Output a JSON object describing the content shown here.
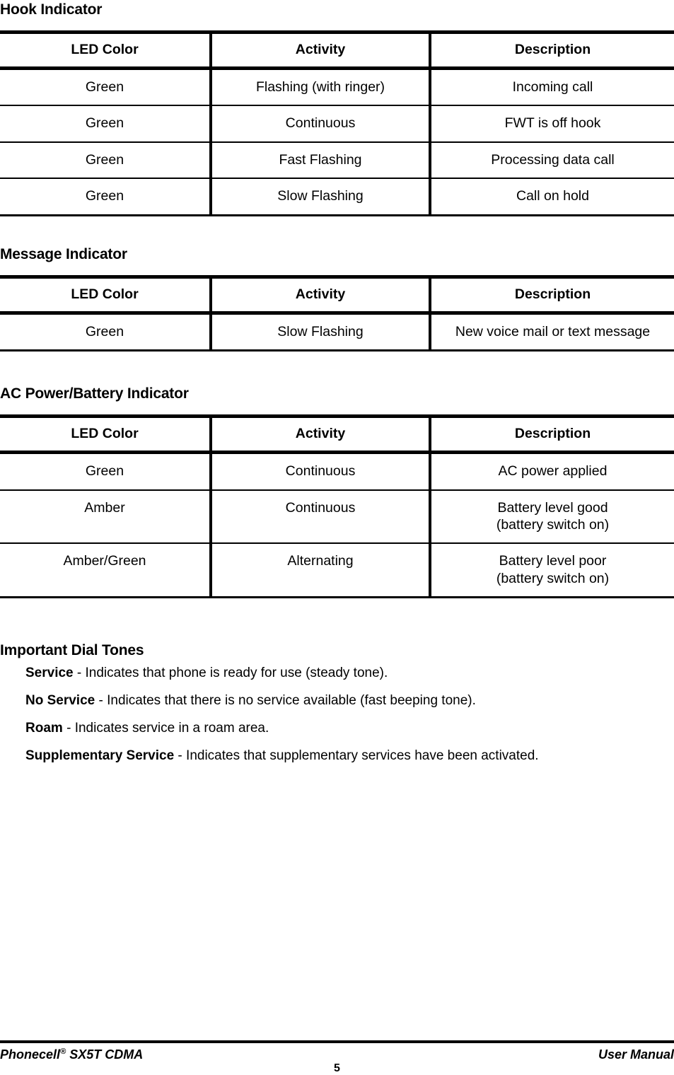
{
  "document": {
    "columns": [
      "LED Color",
      "Activity",
      "Description"
    ]
  },
  "sections": [
    {
      "heading": "Hook Indicator",
      "table": {
        "headers": [
          "LED Color",
          "Activity",
          "Description"
        ],
        "rows": [
          [
            "Green",
            "Flashing (with ringer)",
            "Incoming call"
          ],
          [
            "Green",
            "Continuous",
            "FWT is off hook"
          ],
          [
            "Green",
            "Fast Flashing",
            "Processing data call"
          ],
          [
            "Green",
            "Slow Flashing",
            "Call on hold"
          ]
        ]
      }
    },
    {
      "heading": "Message Indicator",
      "table": {
        "headers": [
          "LED Color",
          "Activity",
          "Description"
        ],
        "rows": [
          [
            "Green",
            "Slow Flashing",
            "New voice mail or text message"
          ]
        ]
      }
    },
    {
      "heading": "AC Power/Battery Indicator",
      "table": {
        "headers": [
          "LED Color",
          "Activity",
          "Description"
        ],
        "rows": [
          [
            "Green",
            "Continuous",
            "AC power applied"
          ],
          [
            "Amber",
            "Continuous",
            "Battery level good\n(battery switch on)"
          ],
          [
            "Amber/Green",
            "Alternating",
            "Battery level poor\n(battery switch on)"
          ]
        ]
      }
    }
  ],
  "dial_tones": {
    "heading": "Important Dial Tones",
    "items": [
      {
        "term": "Service",
        "separator": " - ",
        "description": "Indicates that phone is ready for use (steady tone)."
      },
      {
        "term": "No Service",
        "separator": " - ",
        "description": "Indicates that there is no service available (fast beeping tone)."
      },
      {
        "term": "Roam",
        "separator": " - ",
        "description": "Indicates service in a roam area."
      },
      {
        "term": "Supplementary Service",
        "separator": " - ",
        "description": "Indicates that supplementary services have been activated."
      }
    ]
  },
  "footer": {
    "left_product": "Phonecell",
    "left_mark": "®",
    "left_model": " SX5T CDMA",
    "page_number": "5",
    "right": "User Manual"
  }
}
